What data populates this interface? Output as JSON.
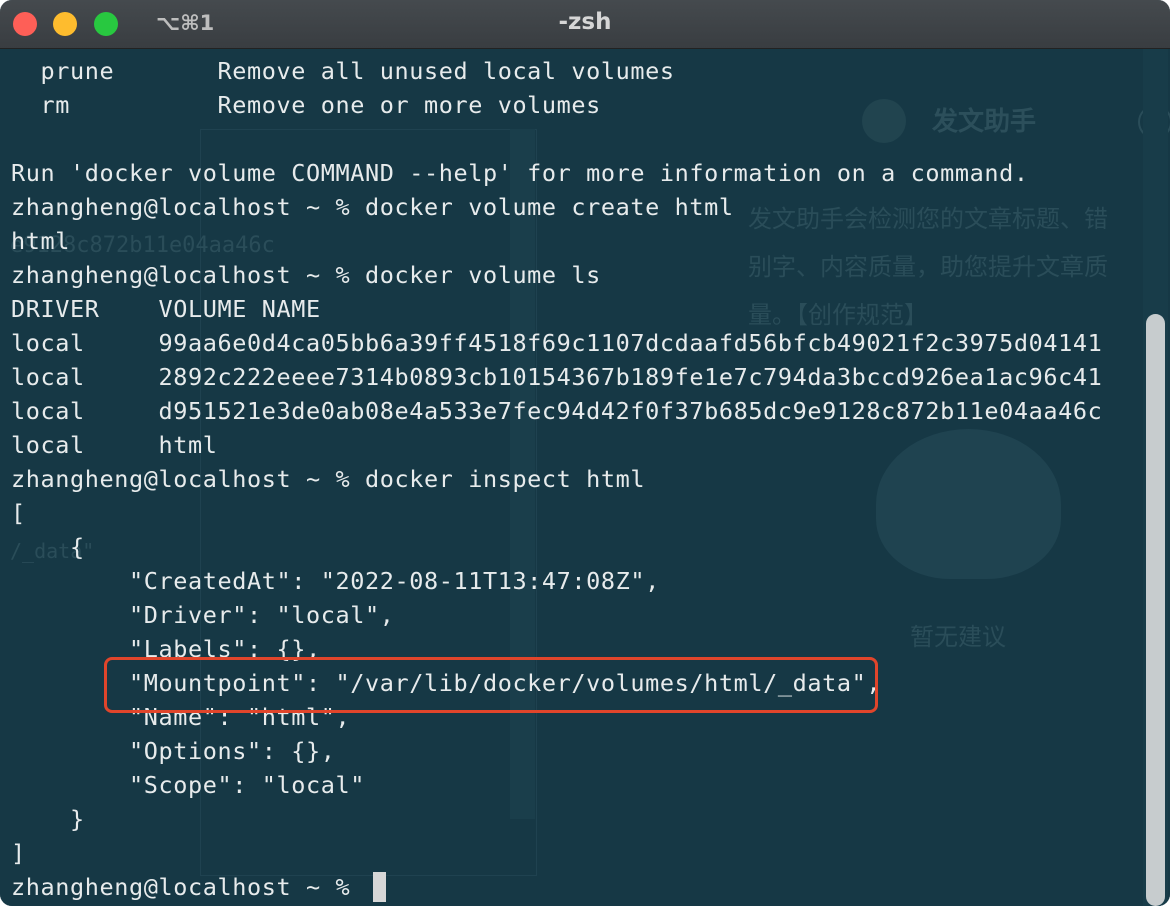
{
  "window": {
    "title": "-zsh",
    "shortcut": "⌥⌘1"
  },
  "terminal": {
    "lines": [
      "  prune       Remove all unused local volumes",
      "  rm          Remove one or more volumes",
      "",
      "Run 'docker volume COMMAND --help' for more information on a command.",
      "zhangheng@localhost ~ % docker volume create html",
      "html",
      "zhangheng@localhost ~ % docker volume ls",
      "DRIVER    VOLUME NAME",
      "local     99aa6e0d4ca05bb6a39ff4518f69c1107dcdaafd56bfcb49021f2c3975d04141",
      "local     2892c222eeee7314b0893cb10154367b189fe1e7c794da3bccd926ea1ac96c41",
      "local     d951521e3de0ab08e4a533e7fec94d42f0f37b685dc9e9128c872b11e04aa46c",
      "local     html",
      "zhangheng@localhost ~ % docker inspect html",
      "[",
      "    {",
      "        \"CreatedAt\": \"2022-08-11T13:47:08Z\",",
      "        \"Driver\": \"local\",",
      "        \"Labels\": {},",
      "        \"Mountpoint\": \"/var/lib/docker/volumes/html/_data\",",
      "        \"Name\": \"html\",",
      "        \"Options\": {},",
      "        \"Scope\": \"local\"",
      "    }",
      "]"
    ],
    "prompt": "zhangheng@localhost ~ % "
  },
  "background": {
    "assistant_title": "发文助手",
    "assistant_line1": "发文助手会检测您的文章标题、错",
    "assistant_line2": "别字、内容质量，助您提升文章质",
    "assistant_line3": "量。【创作规范】",
    "empty_state": "暂无建议",
    "faint_hash": "e9128c872b11e04aa46c",
    "faint_side": "/_data\""
  },
  "colors": {
    "background": "#163845",
    "text": "#e7ebec",
    "highlight": "#e0452b"
  }
}
